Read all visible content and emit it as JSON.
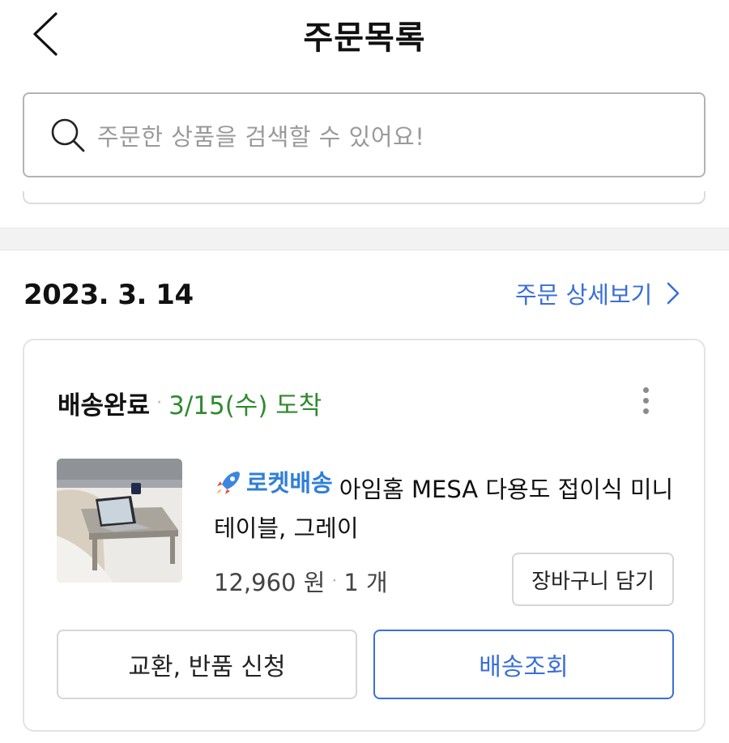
{
  "header": {
    "title": "주문목록",
    "back_icon": "chevron-left-icon"
  },
  "search": {
    "placeholder": "주문한 상품을 검색할 수 있어요!",
    "icon": "search-icon"
  },
  "order": {
    "date": "2023. 3. 14",
    "detail_link": "주문 상세보기"
  },
  "card": {
    "status": "배송완료",
    "separator": "·",
    "arrival": "3/15(수) 도착",
    "product": {
      "badge": "로켓배송",
      "name": "아임홈 MESA 다용도 접이식 미니 테이블, 그레이",
      "price": "12,960 원",
      "separator": "·",
      "quantity": "1 개"
    },
    "cart_button": "장바구니 담기",
    "return_button": "교환, 반품 신청",
    "track_button": "배송조회"
  },
  "colors": {
    "accent_blue": "#3a6fd8",
    "arrival_green": "#2f8a2f",
    "rocket_blue": "#2f7fd8"
  }
}
